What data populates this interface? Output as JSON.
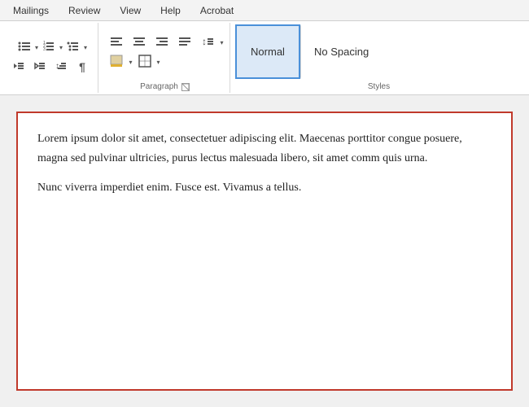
{
  "tabs": [
    {
      "label": "Mailings",
      "active": false
    },
    {
      "label": "Review",
      "active": false
    },
    {
      "label": "View",
      "active": false
    },
    {
      "label": "Help",
      "active": false
    },
    {
      "label": "Acrobat",
      "active": false
    }
  ],
  "ribbon": {
    "paragraph_section": {
      "label": "Paragraph",
      "expand_title": "Paragraph Settings"
    },
    "styles_section": {
      "label": "Styles",
      "normal_label": "Normal",
      "nospacing_label": "No Spacing"
    }
  },
  "document": {
    "paragraph1": "Lorem ipsum dolor sit amet, consectetuer adipiscing elit. Maecenas porttitor congue posuere, magna sed pulvinar ultricies, purus lectus malesuada libero, sit amet comm quis urna.",
    "paragraph2": "Nunc viverra imperdiet enim. Fusce est. Vivamus a tellus."
  }
}
